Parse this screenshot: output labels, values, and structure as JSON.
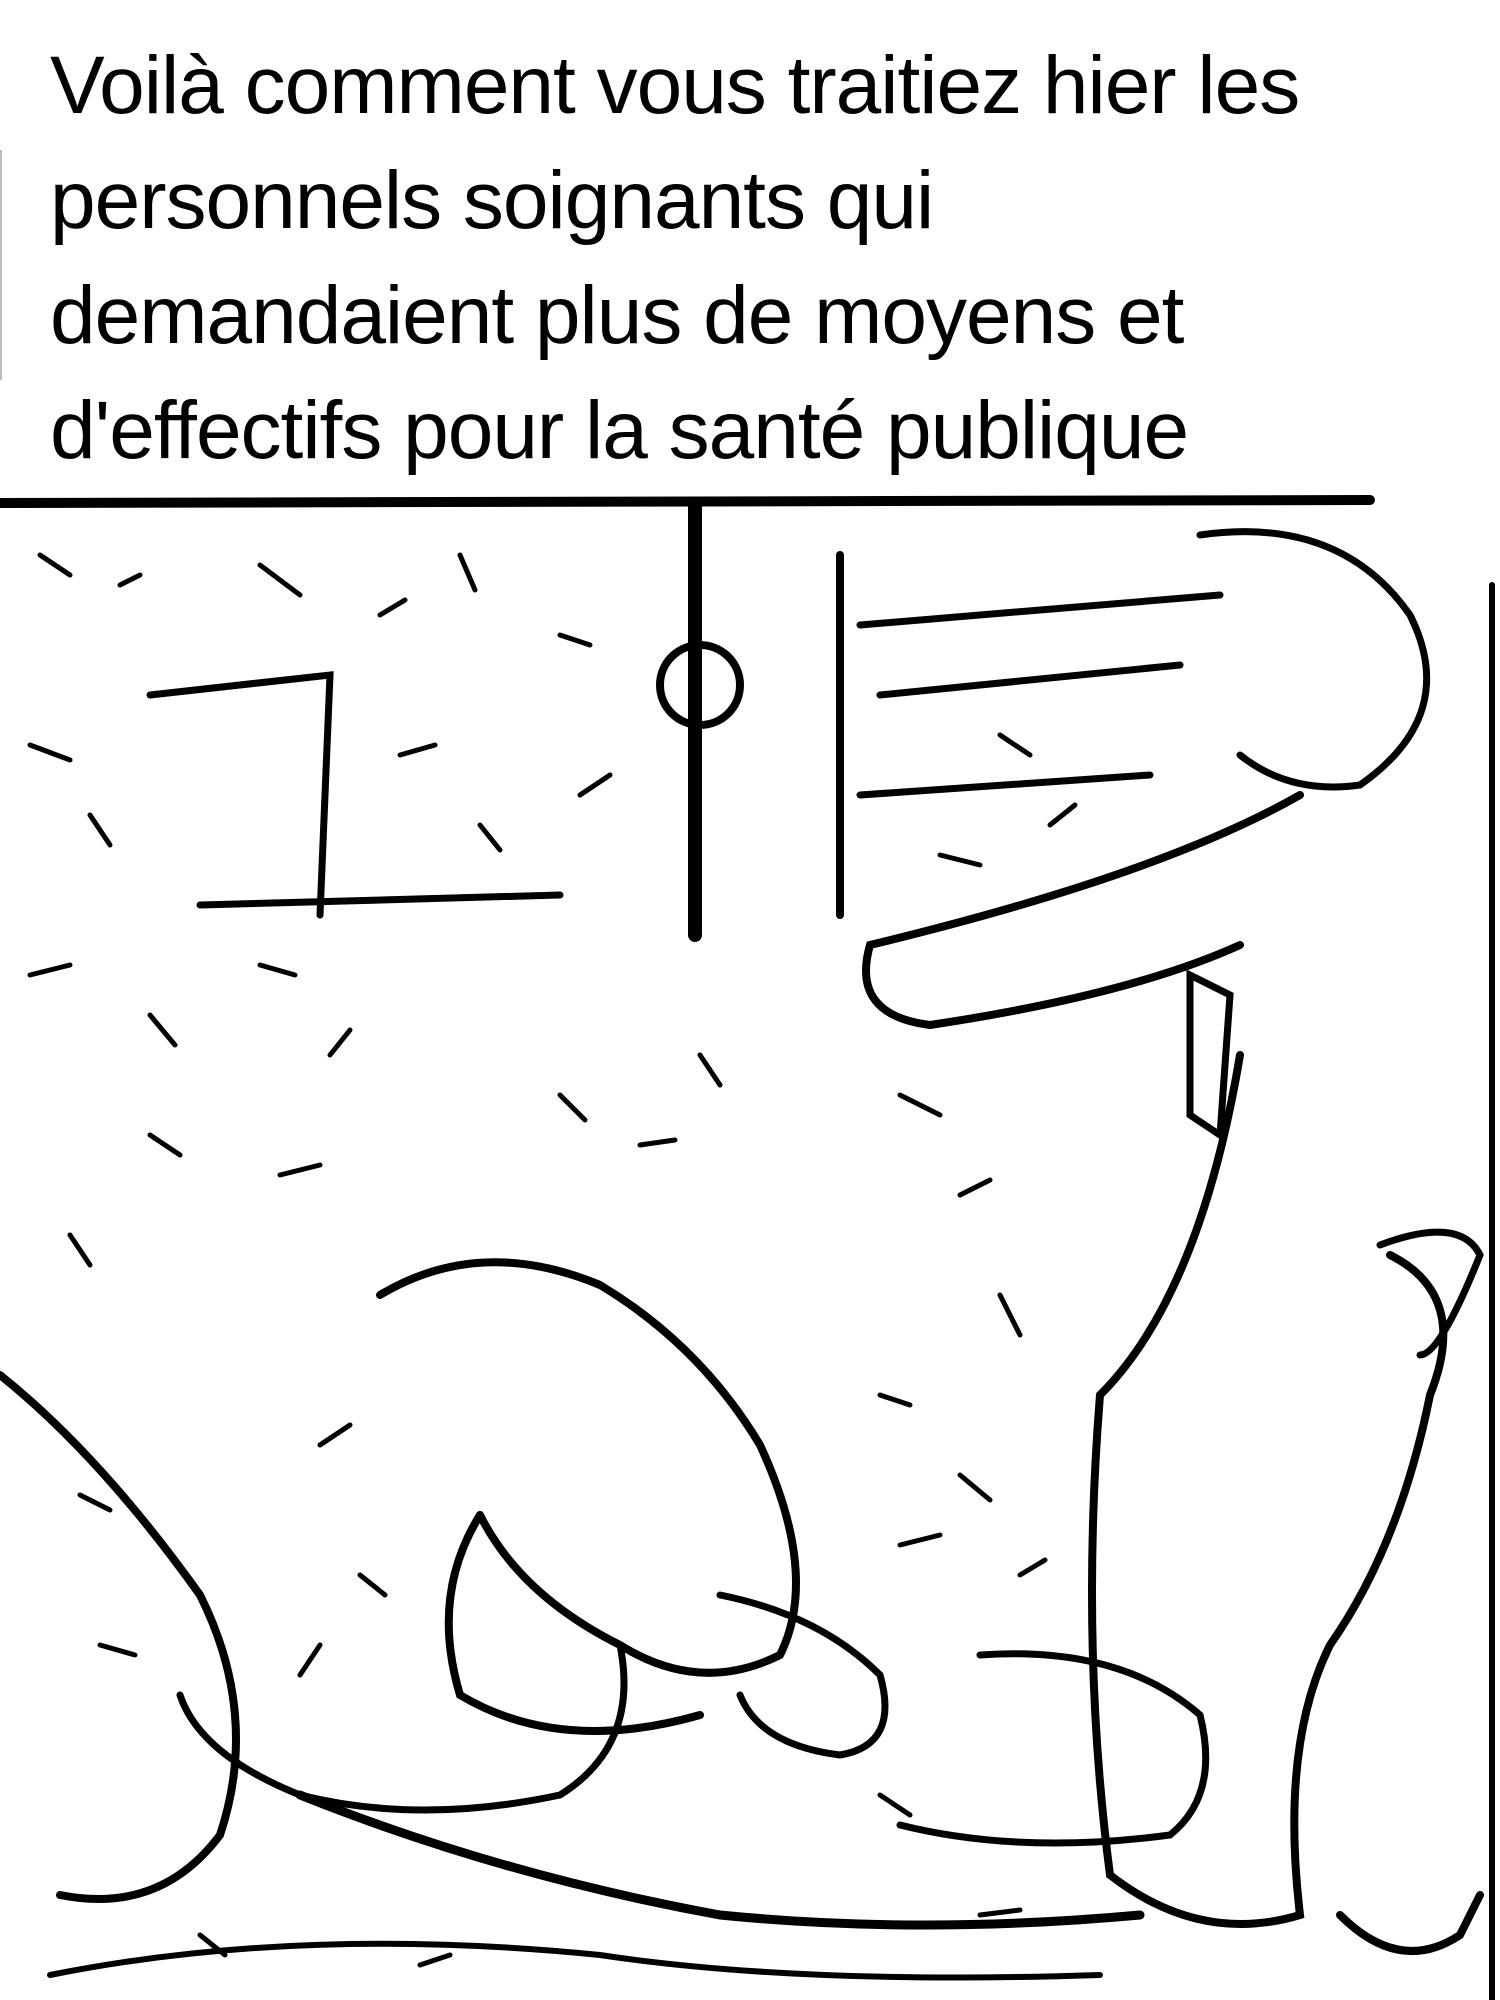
{
  "caption": {
    "lines": [
      "Voilà comment vous traitiez hier les",
      "personnels soignants qui",
      "demandaient plus de moyens et",
      "d'effectifs pour la santé publique"
    ]
  },
  "photo": {
    "style": "high-contrast black and white line-art photo"
  }
}
